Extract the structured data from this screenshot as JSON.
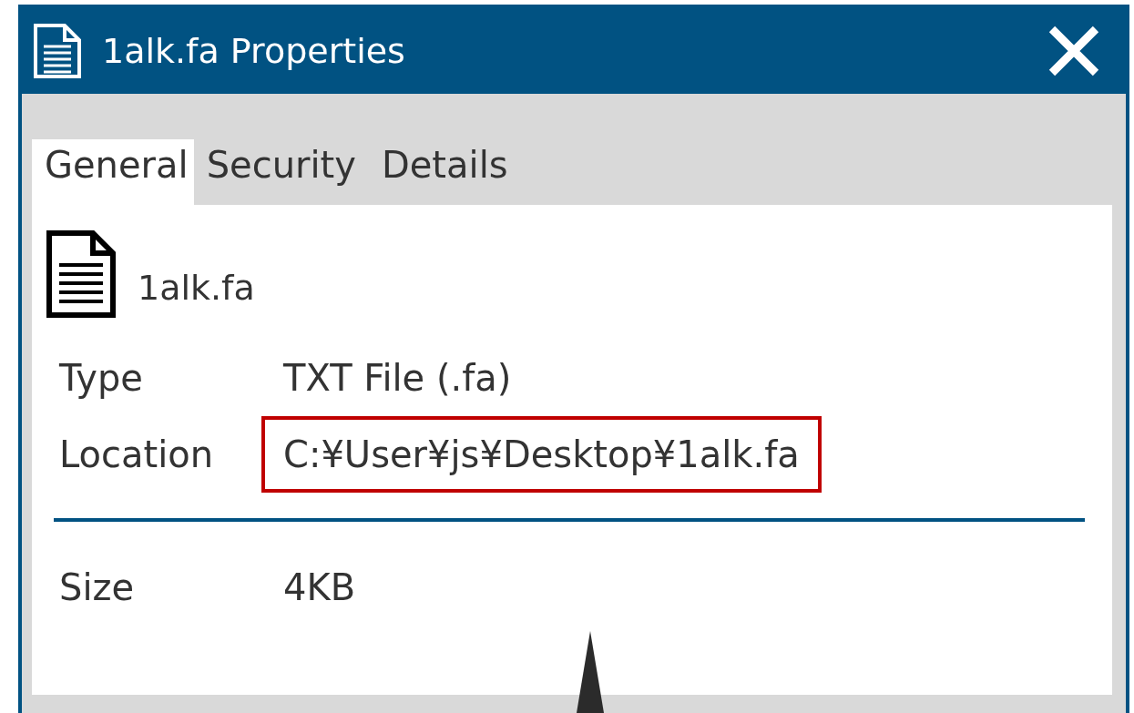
{
  "window": {
    "title": "1alk.fa Properties"
  },
  "tabs": [
    {
      "label": "General",
      "selected": true
    },
    {
      "label": "Security",
      "selected": false
    },
    {
      "label": "Details",
      "selected": false
    }
  ],
  "file": {
    "name": "1alk.fa"
  },
  "properties": [
    {
      "label": "Type",
      "value": "TXT File (.fa)",
      "highlighted": false
    },
    {
      "label": "Location",
      "value": "C:¥User¥js¥Desktop¥1alk.fa",
      "highlighted": true
    }
  ],
  "size_properties": [
    {
      "label": "Size",
      "value": "4KB",
      "highlighted": false
    }
  ]
}
